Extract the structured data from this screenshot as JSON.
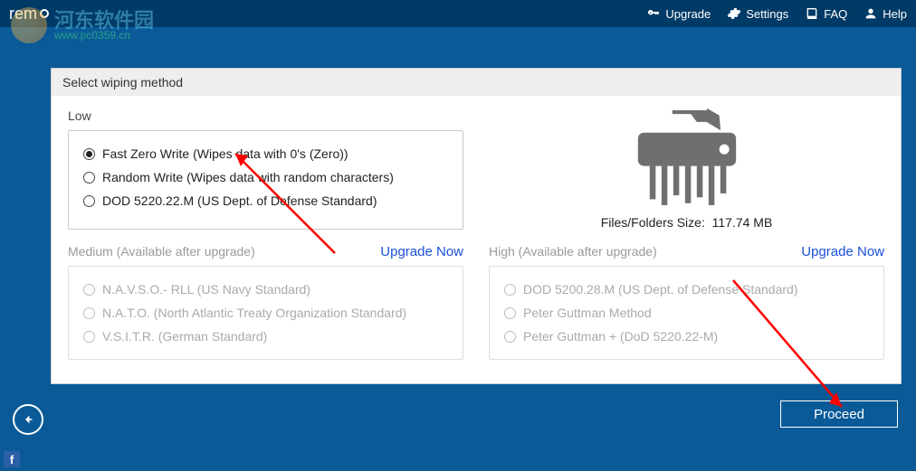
{
  "topnav": {
    "upgrade": "Upgrade",
    "settings": "Settings",
    "faq": "FAQ",
    "help": "Help"
  },
  "watermark": {
    "cn": "河东软件园",
    "url": "www.pc0359.cn"
  },
  "card": {
    "title": "Select wiping method",
    "low_label": "Low",
    "options_low": {
      "o1": "Fast Zero Write (Wipes data with 0's (Zero))",
      "o2": "Random Write (Wipes data with random characters)",
      "o3": "DOD 5220.22.M (US Dept. of Defense Standard)"
    },
    "medium_label": "Medium (Available after upgrade)",
    "high_label": "High (Available after upgrade)",
    "upgrade_link": "Upgrade Now",
    "options_med": {
      "o1": "N.A.V.S.O.- RLL (US Navy Standard)",
      "o2": "N.A.T.O. (North Atlantic Treaty Organization Standard)",
      "o3": "V.S.I.T.R. (German Standard)"
    },
    "options_high": {
      "o1": "DOD 5200.28.M (US Dept. of Defense Standard)",
      "o2": "Peter Guttman Method",
      "o3": "Peter Guttman + (DoD 5220.22-M)"
    },
    "size_label": "Files/Folders Size:",
    "size_value": "117.74 MB"
  },
  "proceed": "Proceed",
  "logo": "remo"
}
